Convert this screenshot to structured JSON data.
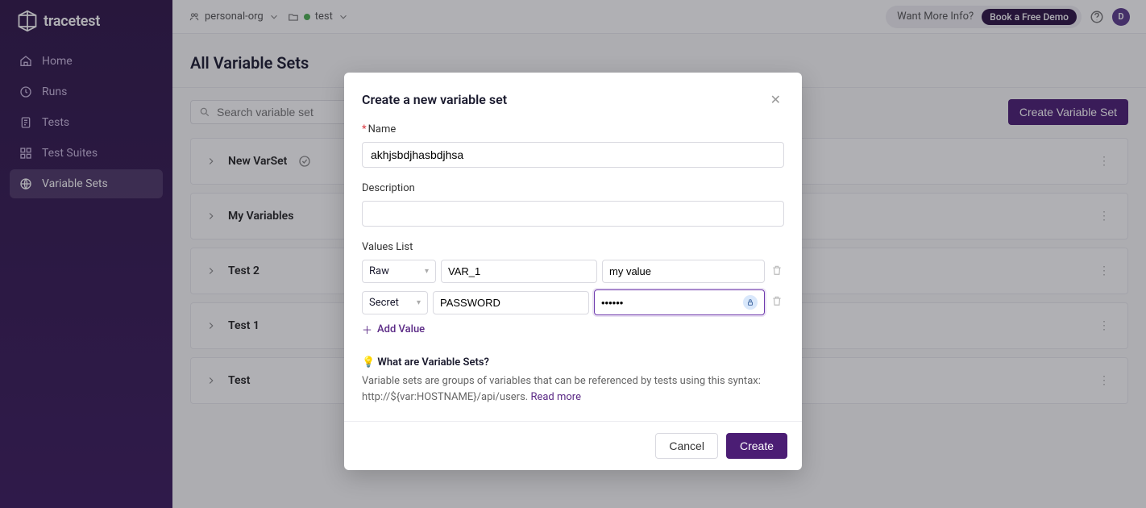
{
  "brand": "tracetest",
  "sidebar": {
    "items": [
      {
        "label": "Home"
      },
      {
        "label": "Runs"
      },
      {
        "label": "Tests"
      },
      {
        "label": "Test Suites"
      },
      {
        "label": "Variable Sets"
      }
    ]
  },
  "topbar": {
    "org": "personal-org",
    "env": "test",
    "info_label": "Want More Info?",
    "demo_label": "Book a Free Demo",
    "avatar_initial": "D"
  },
  "page": {
    "title": "All Variable Sets",
    "search_placeholder": "Search variable set",
    "create_button": "Create Variable Set"
  },
  "rows": [
    {
      "name": "New VarSet",
      "checked": true
    },
    {
      "name": "My Variables",
      "checked": false
    },
    {
      "name": "Test 2",
      "checked": false
    },
    {
      "name": "Test 1",
      "checked": false
    },
    {
      "name": "Test",
      "checked": false
    }
  ],
  "modal": {
    "title": "Create a new variable set",
    "name_label": "Name",
    "name_value": "akhjsbdjhasbdjhsa",
    "desc_label": "Description",
    "desc_value": "",
    "values_label": "Values List",
    "values": [
      {
        "type": "Raw",
        "key": "VAR_1",
        "value": "my value",
        "secret": false
      },
      {
        "type": "Secret",
        "key": "PASSWORD",
        "value": "••••••",
        "secret": true
      }
    ],
    "add_value": "Add Value",
    "tip_title": "What are Variable Sets?",
    "tip_body": "Variable sets are groups of variables that can be referenced by tests using this syntax: http://${var:HOSTNAME}/api/users. ",
    "tip_link": "Read more",
    "cancel": "Cancel",
    "create": "Create"
  }
}
